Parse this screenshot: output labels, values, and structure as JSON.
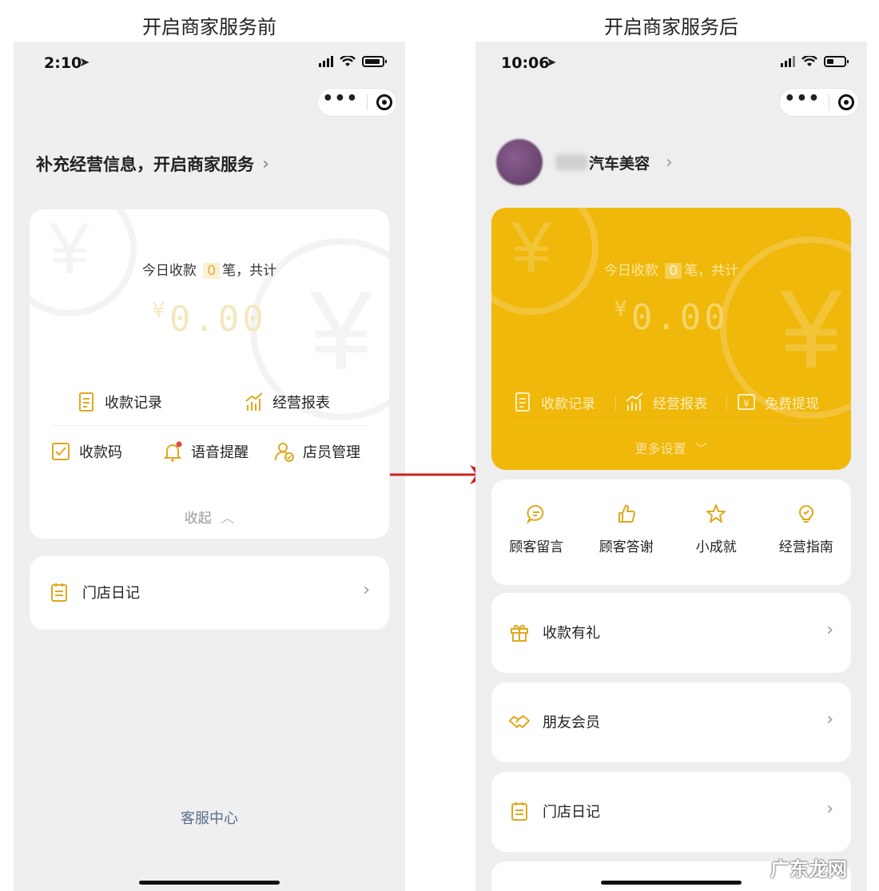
{
  "captions": {
    "before": "开启商家服务前",
    "after": "开启商家服务后"
  },
  "left": {
    "time": "2:10",
    "banner": "补充经营信息，开启商家服务",
    "today_prefix": "今日收款",
    "today_count": "0",
    "today_suffix": "笔，共计",
    "currency": "¥",
    "amount": "0.00",
    "menu_row1": [
      "收款记录",
      "经营报表"
    ],
    "menu_row2": [
      "收款码",
      "语音提醒",
      "店员管理"
    ],
    "collapse": "收起",
    "diary": "门店日记",
    "service_center": "客服中心"
  },
  "right": {
    "time": "10:06",
    "shop_name_suffix": "汽车美容",
    "today_prefix": "今日收款",
    "today_count": "0",
    "today_suffix": "笔，共计",
    "currency": "¥",
    "amount": "0.00",
    "actions": [
      "收款记录",
      "经营报表",
      "免费提现"
    ],
    "more_settings": "更多设置",
    "features": [
      "顾客留言",
      "顾客答谢",
      "小成就",
      "经营指南"
    ],
    "list": [
      "收款有礼",
      "朋友会员",
      "门店日记"
    ]
  },
  "watermark": "广东龙网",
  "colors": {
    "accent": "#f0b80a",
    "icon_gold": "#e0a81e",
    "arrow": "#c8241c"
  }
}
